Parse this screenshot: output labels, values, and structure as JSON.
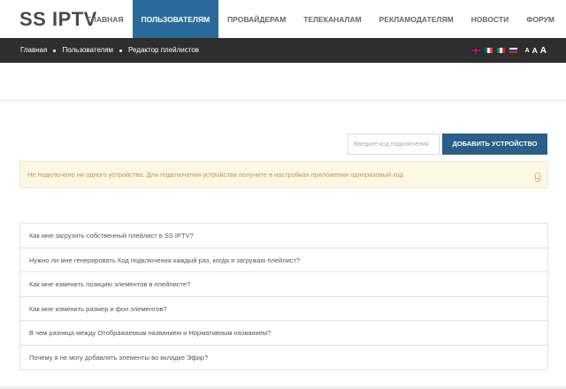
{
  "header": {
    "logo": "SS IPTV",
    "nav": [
      {
        "label": "Главная",
        "active": false
      },
      {
        "label": "Пользователям",
        "active": true
      },
      {
        "label": "Провайдерам",
        "active": false
      },
      {
        "label": "Телеканалам",
        "active": false
      },
      {
        "label": "Рекламодателям",
        "active": false
      },
      {
        "label": "Новости",
        "active": false
      },
      {
        "label": "Форум",
        "active": false
      }
    ],
    "accent_color": "#2a6a9a"
  },
  "breadcrumb": {
    "items": [
      "Главная",
      "Пользователям",
      "Редактор плейлистов"
    ],
    "languages": [
      "en-flag-icon",
      "fr-flag-icon",
      "it-flag-icon",
      "ru-flag-icon"
    ],
    "font_sizes": [
      "A",
      "A",
      "A"
    ]
  },
  "device": {
    "placeholder": "Введите код подключения",
    "value": "",
    "button_label": "Добавить устройство",
    "button_color": "#2a5f8a"
  },
  "alert": {
    "text": "Не подключено ни одного устройства. Для подключения устройства получите в настройках приложения одноразовый код",
    "icon": "mobile-device-icon"
  },
  "faq": [
    "Как мне загрузить собственный плейлист в SS IPTV?",
    "Нужно ли мне генерировать Код подключения каждый раз, когда я загружаю плейлист?",
    "Как мне изменить позицию элементов в плейлисте?",
    "Как мне изменить размер и фон элементов?",
    "В чем разница между Отображаемым названием и Нормативным названием?",
    "Почему я не могу добавлять элементы во вкладке Эфир?"
  ]
}
